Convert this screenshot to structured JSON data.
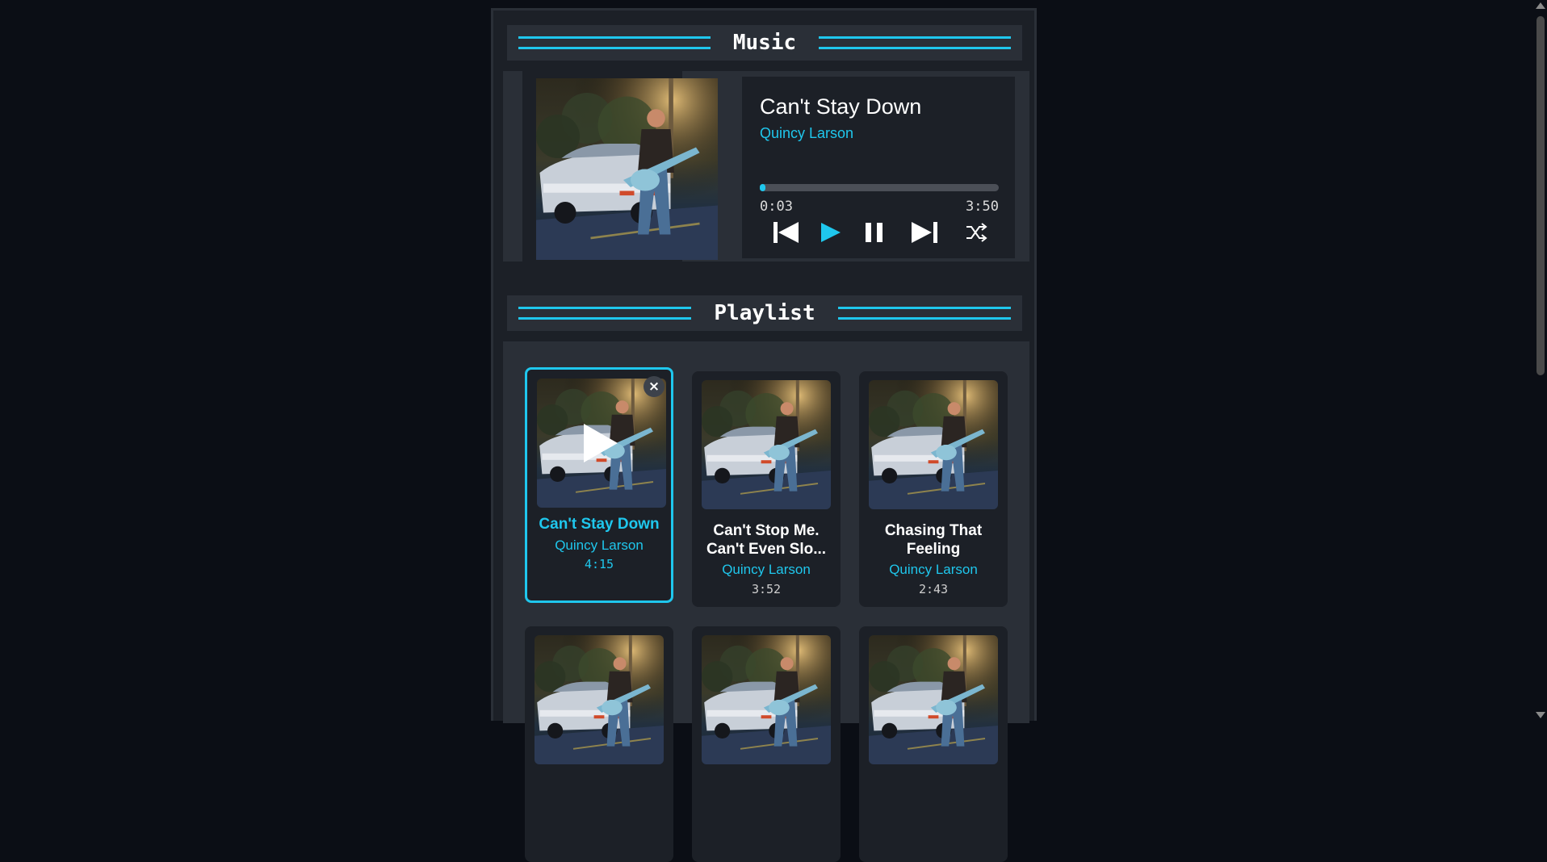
{
  "player": {
    "header_title": "Music",
    "song_title": "Can't Stay Down",
    "song_artist": "Quincy Larson",
    "progress_fraction": 0.013,
    "current_time": "0:03",
    "total_time": "3:50",
    "controls": [
      "previous-icon",
      "play-icon",
      "pause-icon",
      "next-icon",
      "shuffle-icon"
    ]
  },
  "playlist": {
    "header_title": "Playlist",
    "remove_symbol": "×",
    "songs": [
      {
        "title": "Can't Stay Down",
        "artist": "Quincy Larson",
        "duration": "4:15",
        "active": true
      },
      {
        "title": "Can't Stop Me. Can't Even Slo...",
        "artist": "Quincy Larson",
        "duration": "3:52",
        "active": false
      },
      {
        "title": "Chasing That Feeling",
        "artist": "Quincy Larson",
        "duration": "2:43",
        "active": false
      }
    ]
  },
  "colors": {
    "accent": "#1fc7ed",
    "background": "#0b0e15",
    "panel": "#1c2027",
    "panel_alt": "#2a2f37"
  }
}
